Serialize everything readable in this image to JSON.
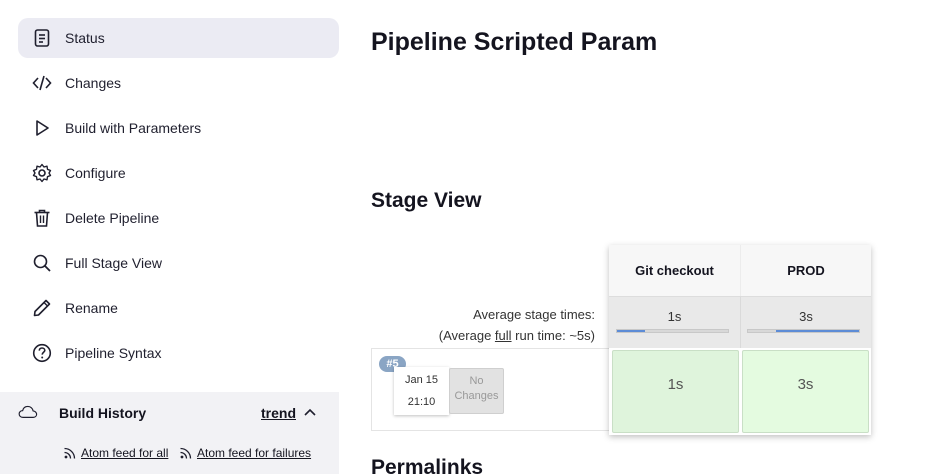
{
  "sidebar": {
    "items": [
      {
        "label": "Status",
        "icon": "document-icon"
      },
      {
        "label": "Changes",
        "icon": "code-icon"
      },
      {
        "label": "Build with Parameters",
        "icon": "play-icon"
      },
      {
        "label": "Configure",
        "icon": "gear-icon"
      },
      {
        "label": "Delete Pipeline",
        "icon": "trash-icon"
      },
      {
        "label": "Full Stage View",
        "icon": "search-icon"
      },
      {
        "label": "Rename",
        "icon": "pencil-icon"
      },
      {
        "label": "Pipeline Syntax",
        "icon": "help-icon"
      }
    ],
    "build_history": {
      "title": "Build History",
      "trend_label": "trend",
      "feed_all": "Atom feed for all",
      "feed_failures": "Atom feed for failures"
    }
  },
  "main": {
    "title": "Pipeline Scripted Param",
    "stage_view_title": "Stage View",
    "permalinks_title": "Permalinks",
    "avg_stage_times": "Average stage times:",
    "avg_full_prefix": "(Average ",
    "avg_full_word": "full",
    "avg_full_suffix": " run time: ~5s)",
    "build": {
      "number": "#5",
      "date": "Jan 15",
      "time": "21:10",
      "changes_line1": "No",
      "changes_line2": "Changes"
    },
    "stages": [
      {
        "name": "Git checkout",
        "avg": "1s",
        "bar_fraction": 0.25,
        "run": "1s"
      },
      {
        "name": "PROD",
        "avg": "3s",
        "bar_fraction": 0.75,
        "run": "3s"
      }
    ]
  },
  "colors": {
    "active_bg": "#ebebf3",
    "success_cell": "#dff4dc",
    "progress_fill": "#5d8cd6",
    "badge": "#8aa5c4"
  }
}
